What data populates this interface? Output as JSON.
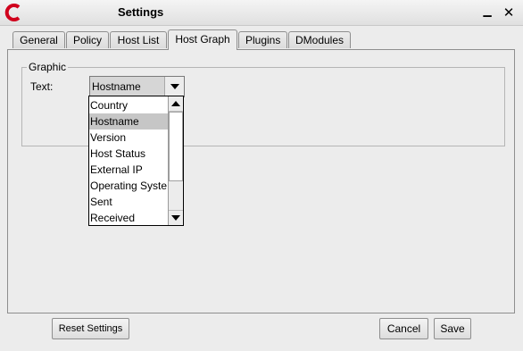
{
  "window": {
    "title": "Settings",
    "minimize_glyph": "▁",
    "close_glyph": "✕",
    "logo_color": "#d0001c"
  },
  "tabs": [
    {
      "label": "General"
    },
    {
      "label": "Policy"
    },
    {
      "label": "Host List"
    },
    {
      "label": "Host Graph",
      "active": true
    },
    {
      "label": "Plugins"
    },
    {
      "label": "DModules"
    }
  ],
  "group": {
    "legend": "Graphic",
    "text_label": "Text:",
    "combo_value": "Hostname"
  },
  "dropdown": {
    "selected": "Hostname",
    "options": [
      "Country",
      "Hostname",
      "Version",
      "Host Status",
      "External IP",
      "Operating Syste",
      "Sent",
      "Received"
    ]
  },
  "buttons": {
    "reset": "Reset Settings",
    "cancel": "Cancel",
    "save": "Save"
  }
}
